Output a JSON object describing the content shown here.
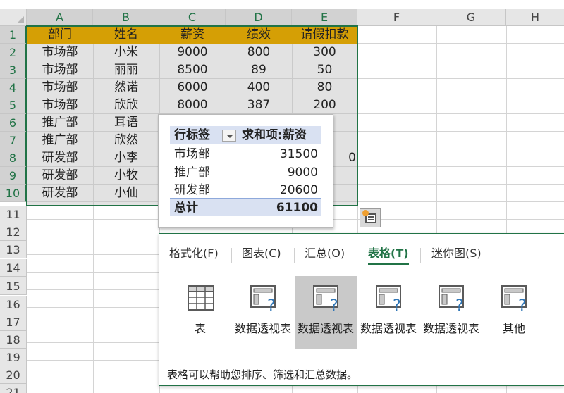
{
  "columns": [
    "A",
    "B",
    "C",
    "D",
    "E",
    "F",
    "G",
    "H"
  ],
  "rows": [
    "1",
    "2",
    "3",
    "4",
    "5",
    "6",
    "7",
    "8",
    "9",
    "10",
    "11",
    "12",
    "13",
    "14",
    "15",
    "16",
    "17",
    "18",
    "19",
    "20",
    "21"
  ],
  "sheet": {
    "header": [
      "部门",
      "姓名",
      "薪资",
      "绩效",
      "请假扣款"
    ],
    "cells": [
      [
        "市场部",
        "小米",
        "9000",
        "800",
        "300"
      ],
      [
        "市场部",
        "丽丽",
        "8500",
        "89",
        "50"
      ],
      [
        "市场部",
        "然诺",
        "6000",
        "400",
        "80"
      ],
      [
        "市场部",
        "欣欣",
        "8000",
        "387",
        "200"
      ],
      [
        "推广部",
        "耳语",
        "",
        "",
        ""
      ],
      [
        "推广部",
        "欣然",
        "",
        "",
        ""
      ],
      [
        "研发部",
        "小李",
        "",
        "",
        "0"
      ],
      [
        "研发部",
        "小牧",
        "",
        "",
        ""
      ],
      [
        "研发部",
        "小仙",
        "",
        "",
        ""
      ]
    ],
    "header_color": "#d59f05",
    "selection_color": "#217346"
  },
  "pivot": {
    "row_label": "行标签",
    "value_label": "求和项:薪资",
    "rows": [
      {
        "label": "市场部",
        "value": "31500"
      },
      {
        "label": "推广部",
        "value": "9000"
      },
      {
        "label": "研发部",
        "value": "20600"
      }
    ],
    "total_label": "总计",
    "total_value": "61100",
    "header_color": "#d9e1f2"
  },
  "quick_analysis": {
    "tabs": [
      {
        "label": "格式化(F)",
        "active": false
      },
      {
        "label": "图表(C)",
        "active": false
      },
      {
        "label": "汇总(O)",
        "active": false
      },
      {
        "label": "表格(T)",
        "active": true
      },
      {
        "label": "迷你图(S)",
        "active": false
      }
    ],
    "tiles": [
      {
        "label": "表",
        "icon": "table-icon"
      },
      {
        "label": "数据透视表",
        "icon": "pivot-table-icon"
      },
      {
        "label": "数据透视表",
        "icon": "pivot-table-icon"
      },
      {
        "label": "数据透视表",
        "icon": "pivot-table-icon"
      },
      {
        "label": "数据透视表",
        "icon": "pivot-table-icon"
      },
      {
        "label": "其他",
        "icon": "more-pivot-icon"
      }
    ],
    "hint": "表格可以帮助您排序、筛选和汇总数据。",
    "accent_color": "#217346"
  }
}
